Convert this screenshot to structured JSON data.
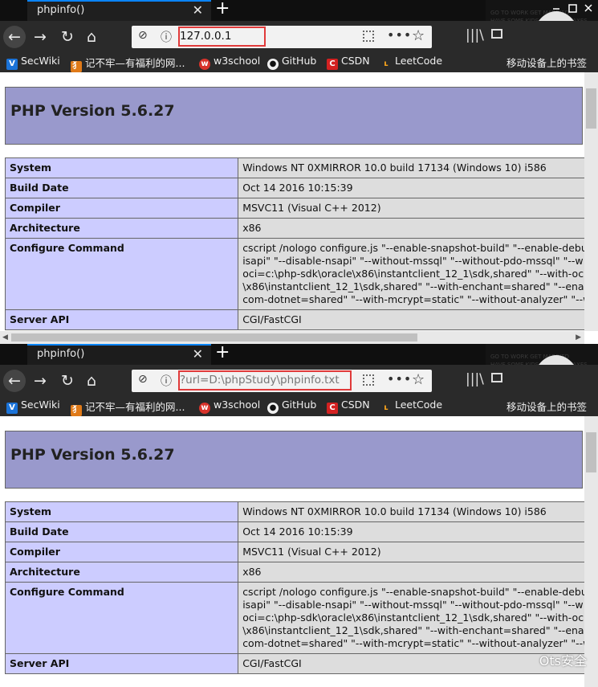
{
  "browser": {
    "tab_title": "phpinfo()",
    "bookmarks": [
      {
        "label": "SecWiki",
        "icon": "secwiki-icon",
        "color": "#1b73d8"
      },
      {
        "label": "记不牢—有福利的网...",
        "icon": "fox-icon",
        "color": "#e07a18"
      },
      {
        "label": "w3school",
        "icon": "w3school-icon",
        "color": "#d8332b"
      },
      {
        "label": "GitHub",
        "icon": "github-icon",
        "color": "#f0f0f0"
      },
      {
        "label": "CSDN",
        "icon": "csdn-icon",
        "color": "#d42121"
      },
      {
        "label": "LeetCode",
        "icon": "leetcode-icon",
        "color": "#f6a21c"
      }
    ],
    "mobile_bookmarks": "移动设备上的书签"
  },
  "windows": [
    {
      "url": "127.0.0.1"
    },
    {
      "url": "?url=D:\\phpStudy\\phpinfo.txt"
    }
  ],
  "phpinfo": {
    "version_title": "PHP Version 5.6.27",
    "rows": [
      {
        "key": "System",
        "value": "Windows NT 0XMIRROR 10.0 build 17134 (Windows 10) i586"
      },
      {
        "key": "Build Date",
        "value": "Oct 14 2016 10:15:39"
      },
      {
        "key": "Compiler",
        "value": "MSVC11 (Visual C++ 2012)"
      },
      {
        "key": "Architecture",
        "value": "x86"
      },
      {
        "key": "Configure Command",
        "value": "cscript /nologo configure.js \"--enable-snapshot-build\" \"--enable-debu\nisapi\" \"--disable-nsapi\" \"--without-mssql\" \"--without-pdo-mssql\" \"--w\noci=c:\\php-sdk\\oracle\\x86\\instantclient_12_1\\sdk,shared\" \"--with-oci8\n\\x86\\instantclient_12_1\\sdk,shared\" \"--with-enchant=shared\" \"--enabl\ncom-dotnet=shared\" \"--with-mcrypt=static\" \"--without-analyzer\" \"--w"
      },
      {
        "key": "Server API",
        "value": "CGI/FastCGI"
      }
    ]
  },
  "watermark": "Ots安全"
}
